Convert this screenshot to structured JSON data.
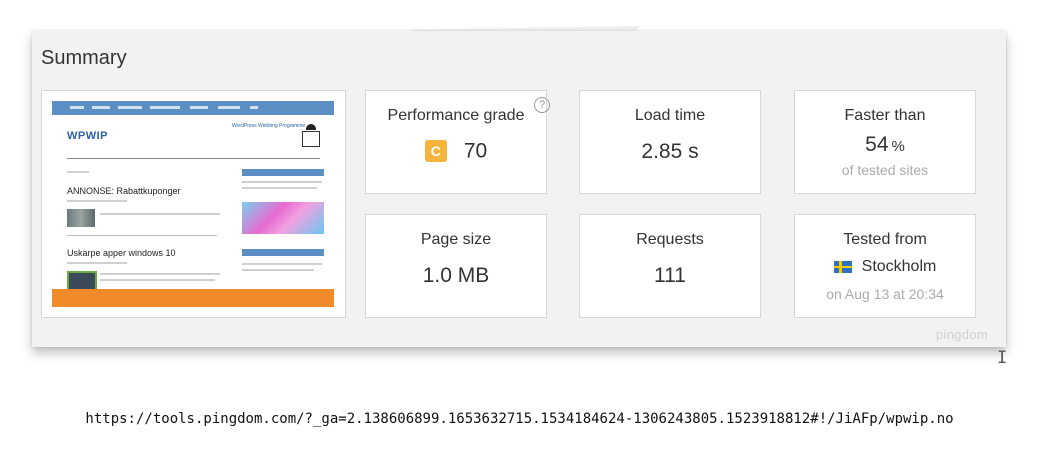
{
  "panel": {
    "title": "Summary",
    "brand": "pingdom"
  },
  "screenshot": {
    "site_logo": "WPWIP",
    "site_tagline": "WordPress Webbing Programme",
    "posts": [
      {
        "title": "ANNONSE: Rabattkuponger"
      },
      {
        "title": "Uskarpe apper windows 10"
      }
    ]
  },
  "cards": {
    "performance": {
      "label": "Performance grade",
      "grade": "C",
      "score": "70",
      "help": "?"
    },
    "load_time": {
      "label": "Load time",
      "value": "2.85 s"
    },
    "faster_than": {
      "label": "Faster than",
      "value": "54",
      "unit": "%",
      "sub": "of tested sites"
    },
    "page_size": {
      "label": "Page size",
      "value": "1.0 MB"
    },
    "requests": {
      "label": "Requests",
      "value": "111"
    },
    "tested_from": {
      "label": "Tested from",
      "location": "Stockholm",
      "date": "on Aug 13 at 20:34"
    }
  },
  "cursor": "I",
  "url": "https://tools.pingdom.com/?_ga=2.138606899.1653632715.1534184624-1306243805.1523918812#!/JiAFp/wpwip.no",
  "colors": {
    "grade_badge": "#f6b43c",
    "panel_bg": "#f2f2f2",
    "site_nav": "#5b8fc4",
    "site_footer": "#f08a2a"
  }
}
